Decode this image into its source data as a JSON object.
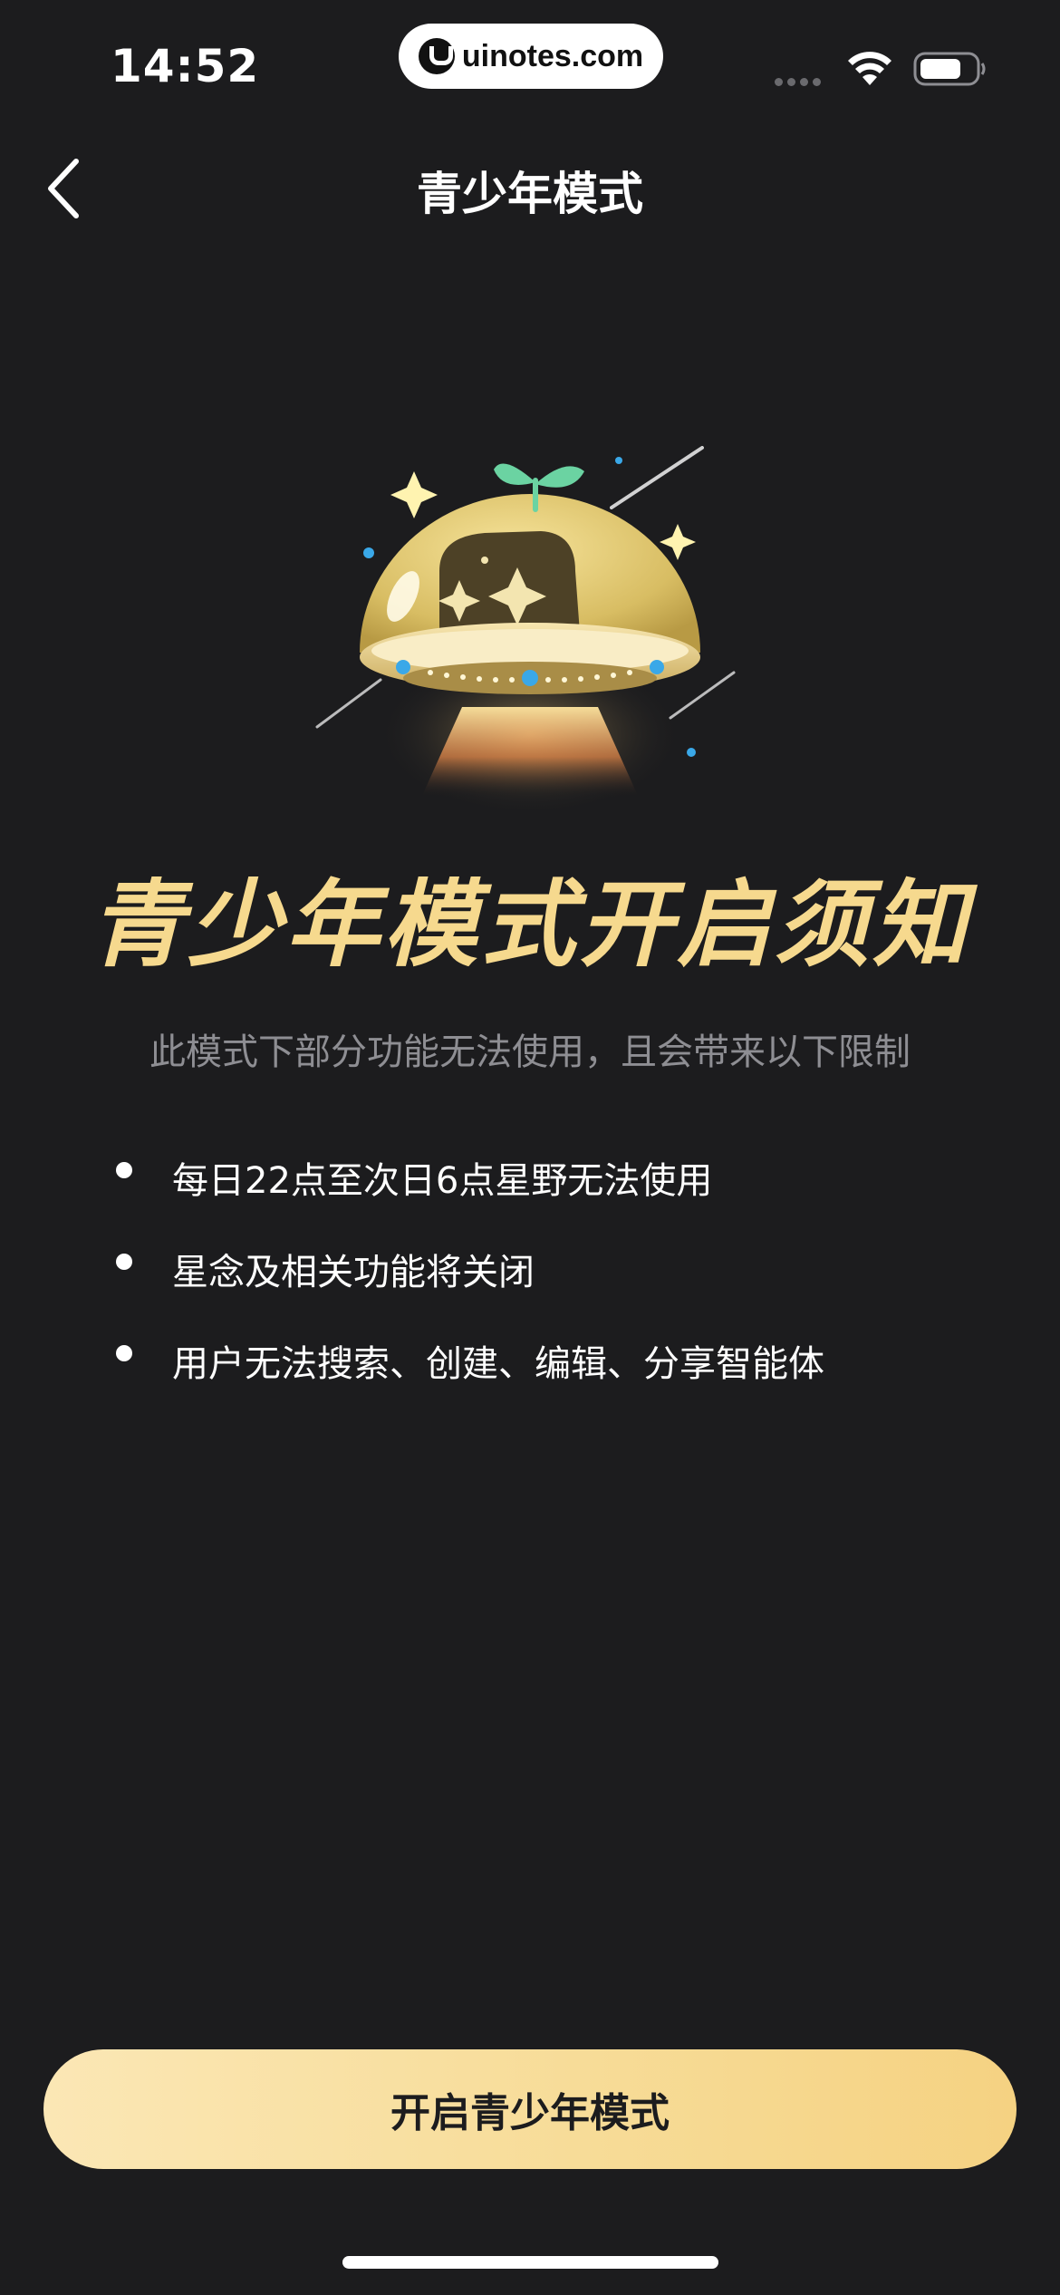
{
  "status_bar": {
    "time": "14:52",
    "watermark": "uinotes.com"
  },
  "nav": {
    "title": "青少年模式",
    "back_icon": "chevron-left-icon"
  },
  "hero": {
    "illustration": "ufo-sprout-icon",
    "headline": "青少年模式开启须知",
    "subtitle": "此模式下部分功能无法使用，且会带来以下限制"
  },
  "rules": [
    {
      "text": "每日22点至次日6点星野无法使用"
    },
    {
      "text": "星念及相关功能将关闭"
    },
    {
      "text": "用户无法搜索、创建、编辑、分享智能体"
    }
  ],
  "footer": {
    "button_label": "开启青少年模式"
  },
  "colors": {
    "background": "#1c1c1e",
    "accent_gold": "#f6d98e",
    "button_gradient_start": "#fbe7b5",
    "button_gradient_end": "#f5d282",
    "muted_text": "#8e8e93"
  }
}
